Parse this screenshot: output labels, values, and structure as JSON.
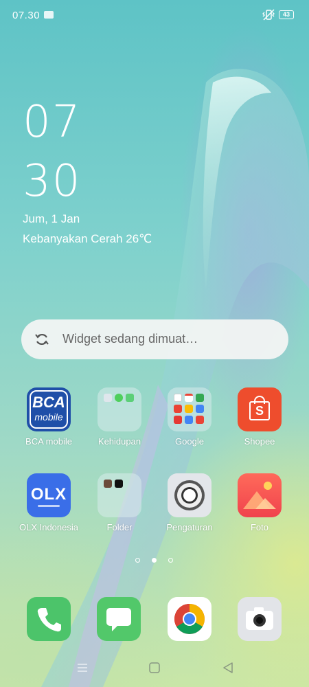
{
  "status_bar": {
    "time": "07.30",
    "battery": "43"
  },
  "clock": {
    "hour": "07",
    "minute": "30",
    "date": "Jum, 1 Jan",
    "weather": "Kebanyakan Cerah 26℃"
  },
  "widget": {
    "text": "Widget sedang dimuat…"
  },
  "apps": [
    {
      "label": "BCA mobile",
      "icon": "bca-mobile-icon"
    },
    {
      "label": "Kehidupan",
      "icon": "folder-icon"
    },
    {
      "label": "Google",
      "icon": "folder-icon"
    },
    {
      "label": "Shopee",
      "icon": "shopee-icon"
    },
    {
      "label": "OLX Indonesia",
      "icon": "olx-icon"
    },
    {
      "label": "Folder",
      "icon": "folder-icon"
    },
    {
      "label": "Pengaturan",
      "icon": "settings-icon"
    },
    {
      "label": "Foto",
      "icon": "photos-icon"
    }
  ],
  "bca_icon": {
    "line1": "BCA",
    "line2": "mobile"
  },
  "olx_icon": {
    "text": "OLX"
  },
  "shopee_icon": {
    "letter": "S"
  },
  "page_indicator": {
    "pages": 3,
    "current": 2
  },
  "dock": [
    {
      "icon": "phone-icon"
    },
    {
      "icon": "messages-icon"
    },
    {
      "icon": "chrome-icon"
    },
    {
      "icon": "camera-icon"
    }
  ],
  "colors": {
    "bca": "#1f4fa8",
    "shopee": "#ee4d2d",
    "olx": "#3a6ee8",
    "phone": "#4cc46a",
    "messages": "#52c86a",
    "photos": "#f2534d"
  }
}
